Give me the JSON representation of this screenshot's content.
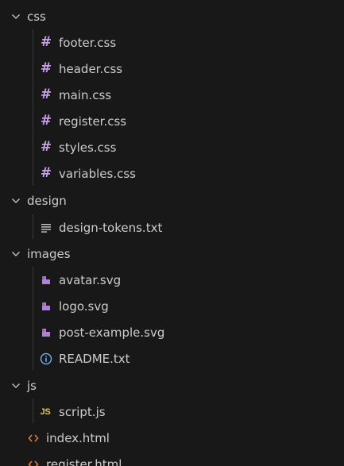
{
  "tree": {
    "css_folder": "css",
    "css_files": [
      "footer.css",
      "header.css",
      "main.css",
      "register.css",
      "styles.css",
      "variables.css"
    ],
    "design_folder": "design",
    "design_files": [
      "design-tokens.txt"
    ],
    "images_folder": "images",
    "images_files": [
      "avatar.svg",
      "logo.svg",
      "post-example.svg",
      "README.txt"
    ],
    "js_folder": "js",
    "js_files": [
      "script.js"
    ],
    "root_files": [
      "index.html",
      "register.html"
    ]
  },
  "colors": {
    "background": "#181818",
    "text": "#cccccc",
    "css_icon": "#c4a0e6",
    "svg_icon": "#b180d7",
    "txt_icon": "#cccccc",
    "info_icon": "#75beff",
    "js_icon": "#e6c84a",
    "html_icon": "#e37933",
    "indent_guide": "#3a3a3a"
  },
  "icons": {
    "folder_chevron": "chevron-down-icon",
    "css_file": "hash-icon",
    "txt_file": "lines-icon",
    "svg_file": "svg-file-icon",
    "readme_file": "info-icon",
    "js_file": "js-icon",
    "html_file": "code-brackets-icon"
  }
}
